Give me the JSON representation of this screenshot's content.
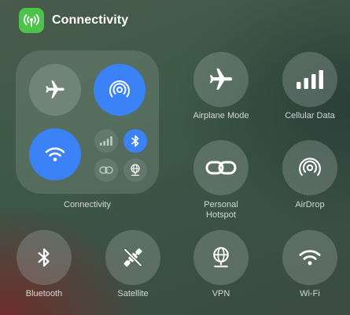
{
  "header": {
    "title": "Connectivity",
    "icon": "antenna-signal-icon",
    "accent": "#4cc34a"
  },
  "module": {
    "label": "Connectivity",
    "items": [
      {
        "name": "airplane-mode",
        "icon": "airplane-icon",
        "on": false
      },
      {
        "name": "airdrop",
        "icon": "airdrop-icon",
        "on": true
      },
      {
        "name": "wifi",
        "icon": "wifi-icon",
        "on": true
      },
      {
        "name": "cellular-data",
        "icon": "cellular-bars-icon",
        "on": false
      },
      {
        "name": "bluetooth",
        "icon": "bluetooth-icon",
        "on": true
      },
      {
        "name": "personal-hotspot",
        "icon": "link-icon",
        "on": false
      },
      {
        "name": "vpn",
        "icon": "globe-network-icon",
        "on": false
      }
    ]
  },
  "controls": {
    "airplane": "Airplane Mode",
    "cellular": "Cellular Data",
    "hotspot_line1": "Personal",
    "hotspot_line2": "Hotspot",
    "airdrop": "AirDrop",
    "bluetooth": "Bluetooth",
    "satellite": "Satellite",
    "vpn": "VPN",
    "wifi": "Wi-Fi"
  },
  "colors": {
    "active_blue": "#3b82f6",
    "button_gray": "rgba(180,190,185,0.28)"
  }
}
